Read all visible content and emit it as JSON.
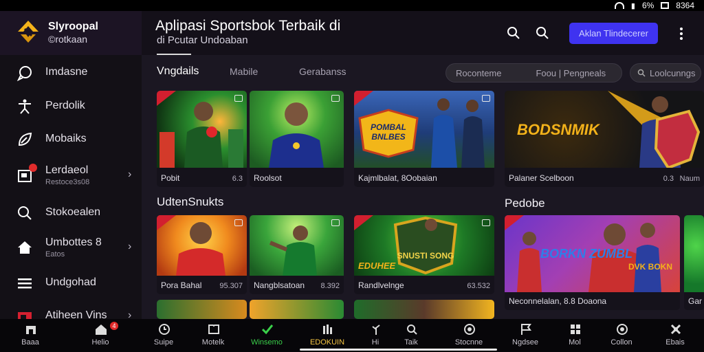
{
  "status_bar": {
    "battery": "6%",
    "time": "8364"
  },
  "brand": {
    "name": "Slyroopal",
    "sub": "©rotkaan",
    "accent": "#f3b21a"
  },
  "header": {
    "title": "Aplipasi Sportsbok Terbaik di",
    "subtitle": "di Pcutar Undoaban",
    "login_label": "Aklan Tlindecerer",
    "login_color": "#3f33f0"
  },
  "sidebar": {
    "items": [
      {
        "label": "Imdasne",
        "icon": "chat-bubble-icon"
      },
      {
        "label": "Perdolik",
        "icon": "sport-player-icon"
      },
      {
        "label": "Mobaiks",
        "icon": "rocket-icon"
      },
      {
        "label": "Lerdaeol",
        "sub": "Restoce3s08",
        "icon": "inbox-icon",
        "badge": true,
        "chevron": "›"
      },
      {
        "label": "Stokoealen",
        "icon": "search-icon"
      },
      {
        "label": "Umbottes 8",
        "sub": "Eatos",
        "icon": "home-icon",
        "chevron": "›"
      },
      {
        "label": "Undgohad",
        "icon": "menu-icon"
      },
      {
        "label": "Atiheen Vins",
        "icon": "ticket-icon",
        "chevron": "›"
      }
    ]
  },
  "tabs": {
    "items": [
      "Vngdails",
      "Mabile",
      "Gerabanss"
    ],
    "filter1": "Roconteme",
    "filter2": "Foou | Pengneals",
    "search": "Loolcunngs"
  },
  "sections": {
    "second": "UdtenSnukts",
    "third": "Pedobe"
  },
  "cards_row1": [
    {
      "cap": "Pobit",
      "num": "6.3"
    },
    {
      "cap": "Roolsot",
      "num": ""
    },
    {
      "cap": "Kajmlbalat, 8Oobaian",
      "num": "",
      "art": "POMBAL BNLBES"
    },
    {
      "cap": "Palaner Scelboon",
      "num": "0.3",
      "num2": "Naum",
      "art": "BODSNMIK"
    }
  ],
  "cards_row2": [
    {
      "cap": "Pora Bahal",
      "num": "95.307"
    },
    {
      "cap": "Nangblsatoan",
      "num": "8.392"
    },
    {
      "cap": "Randlvelnge",
      "num": "63.532",
      "art": "SNUSTI SONG",
      "art2": "EDUHEE"
    },
    {
      "cap": "Neconnelalan, 8.8 Doaona",
      "num": "",
      "art": "BORKN ZUMBL",
      "art2": "DVK BOKN"
    },
    {
      "cap": "Gar",
      "num": ""
    }
  ],
  "bottom_nav": [
    {
      "label": "Baaa",
      "icon": "store-icon"
    },
    {
      "label": "Helio",
      "icon": "house-icon",
      "badge": "4"
    },
    {
      "label": "Suipe",
      "icon": "clock-icon"
    },
    {
      "label": "Motelk",
      "icon": "book-icon"
    },
    {
      "label": "Winsemo",
      "icon": "check-icon",
      "state": "active"
    },
    {
      "label": "EDOKUIN",
      "icon": "bars-icon",
      "state": "highlight"
    },
    {
      "label": "Hi",
      "icon": "plant-icon"
    },
    {
      "label": "Taik",
      "icon": "search-icon"
    },
    {
      "label": "Stocnne",
      "icon": "target-icon"
    },
    {
      "label": "Ngdsee",
      "icon": "flag-icon"
    },
    {
      "label": "Mol",
      "icon": "grid-icon"
    },
    {
      "label": "Collon",
      "icon": "circle-icon"
    },
    {
      "label": "Ebais",
      "icon": "puzzle-icon"
    }
  ]
}
